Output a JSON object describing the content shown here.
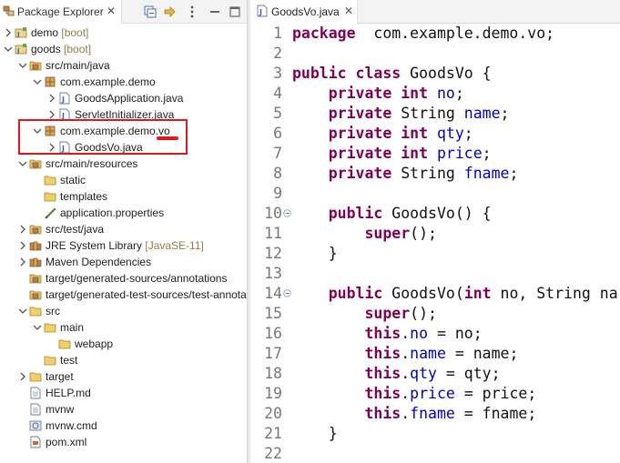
{
  "explorer": {
    "tab_title": "Package Explorer",
    "tab_close": "✕",
    "toolbar_icons": [
      "collapse-all-icon",
      "link-with-editor-icon",
      "focus-icon",
      "view-menu-icon"
    ]
  },
  "tree": [
    {
      "label": "demo",
      "decor": " [boot]",
      "icon": "project-icon",
      "arrow": "collapsed"
    },
    {
      "label": "goods",
      "decor": " [boot]",
      "icon": "project-icon",
      "arrow": "expanded"
    },
    {
      "label": "src/main/java",
      "decor": "",
      "icon": "source-folder-icon",
      "arrow": "expanded"
    },
    {
      "label": "com.example.demo",
      "decor": "",
      "icon": "package-icon",
      "arrow": "expanded"
    },
    {
      "label": "GoodsApplication.java",
      "decor": "",
      "icon": "java-file-icon",
      "arrow": "collapsed"
    },
    {
      "label": "ServletInitializer.java",
      "decor": "",
      "icon": "java-file-icon",
      "arrow": "collapsed"
    },
    {
      "label": "com.example.demo.vo",
      "decor": "",
      "icon": "package-icon",
      "arrow": "expanded"
    },
    {
      "label": "GoodsVo.java",
      "decor": "",
      "icon": "java-file-icon",
      "arrow": "collapsed"
    },
    {
      "label": "src/main/resources",
      "decor": "",
      "icon": "source-folder-icon",
      "arrow": "expanded"
    },
    {
      "label": "static",
      "decor": "",
      "icon": "folder-icon",
      "arrow": "none"
    },
    {
      "label": "templates",
      "decor": "",
      "icon": "folder-icon",
      "arrow": "none"
    },
    {
      "label": "application.properties",
      "decor": "",
      "icon": "properties-file-icon",
      "arrow": "none"
    },
    {
      "label": "src/test/java",
      "decor": "",
      "icon": "source-folder-icon",
      "arrow": "collapsed"
    },
    {
      "label": "JRE System Library",
      "decor": " [JavaSE-11]",
      "icon": "library-icon",
      "arrow": "collapsed"
    },
    {
      "label": "Maven Dependencies",
      "decor": "",
      "icon": "library-icon",
      "arrow": "collapsed"
    },
    {
      "label": "target/generated-sources/annotations",
      "decor": "",
      "icon": "source-folder-icon",
      "arrow": "none"
    },
    {
      "label": "target/generated-test-sources/test-annotations",
      "decor": "",
      "icon": "source-folder-icon",
      "arrow": "none"
    },
    {
      "label": "src",
      "decor": "",
      "icon": "folder-icon",
      "arrow": "expanded"
    },
    {
      "label": "main",
      "decor": "",
      "icon": "folder-icon",
      "arrow": "expanded"
    },
    {
      "label": "webapp",
      "decor": "",
      "icon": "folder-icon",
      "arrow": "none"
    },
    {
      "label": "test",
      "decor": "",
      "icon": "folder-icon",
      "arrow": "none"
    },
    {
      "label": "target",
      "decor": "",
      "icon": "folder-icon",
      "arrow": "collapsed"
    },
    {
      "label": "HELP.md",
      "decor": "",
      "icon": "text-file-icon",
      "arrow": "none"
    },
    {
      "label": "mvnw",
      "decor": "",
      "icon": "text-file-icon",
      "arrow": "none"
    },
    {
      "label": "mvnw.cmd",
      "decor": "",
      "icon": "cmd-file-icon",
      "arrow": "none"
    },
    {
      "label": "pom.xml",
      "decor": "",
      "icon": "xml-file-icon",
      "arrow": "none"
    }
  ],
  "editor": {
    "tab_title": "GoodsVo.java",
    "tab_close": "✕",
    "lines": [
      {
        "n": "1",
        "fold": false,
        "tokens": [
          [
            "kw",
            "package"
          ],
          [
            "",
            "  com.example.demo.vo;"
          ]
        ]
      },
      {
        "n": "2",
        "fold": false,
        "tokens": []
      },
      {
        "n": "3",
        "fold": false,
        "tokens": [
          [
            "kw",
            "public"
          ],
          [
            "",
            " "
          ],
          [
            "kw",
            "class"
          ],
          [
            "",
            " GoodsVo {"
          ]
        ]
      },
      {
        "n": "4",
        "fold": false,
        "tokens": [
          [
            "",
            "    "
          ],
          [
            "kw",
            "private"
          ],
          [
            "",
            " "
          ],
          [
            "kw",
            "int"
          ],
          [
            "",
            " "
          ],
          [
            "fld",
            "no"
          ],
          [
            "",
            ";"
          ]
        ]
      },
      {
        "n": "5",
        "fold": false,
        "tokens": [
          [
            "",
            "    "
          ],
          [
            "kw",
            "private"
          ],
          [
            "",
            " String "
          ],
          [
            "fld",
            "name"
          ],
          [
            "",
            ";"
          ]
        ]
      },
      {
        "n": "6",
        "fold": false,
        "tokens": [
          [
            "",
            "    "
          ],
          [
            "kw",
            "private"
          ],
          [
            "",
            " "
          ],
          [
            "kw",
            "int"
          ],
          [
            "",
            " "
          ],
          [
            "fld",
            "qty"
          ],
          [
            "",
            ";"
          ]
        ]
      },
      {
        "n": "7",
        "fold": false,
        "tokens": [
          [
            "",
            "    "
          ],
          [
            "kw",
            "private"
          ],
          [
            "",
            " "
          ],
          [
            "kw",
            "int"
          ],
          [
            "",
            " "
          ],
          [
            "fld",
            "price"
          ],
          [
            "",
            ";"
          ]
        ]
      },
      {
        "n": "8",
        "fold": false,
        "tokens": [
          [
            "",
            "    "
          ],
          [
            "kw",
            "private"
          ],
          [
            "",
            " String "
          ],
          [
            "fld",
            "fname"
          ],
          [
            "",
            ";"
          ]
        ]
      },
      {
        "n": "9",
        "fold": false,
        "tokens": []
      },
      {
        "n": "10",
        "fold": true,
        "tokens": [
          [
            "",
            "    "
          ],
          [
            "kw",
            "public"
          ],
          [
            "",
            " GoodsVo() {"
          ]
        ]
      },
      {
        "n": "11",
        "fold": false,
        "tokens": [
          [
            "",
            "        "
          ],
          [
            "kw",
            "super"
          ],
          [
            "",
            "();"
          ]
        ]
      },
      {
        "n": "12",
        "fold": false,
        "tokens": [
          [
            "",
            "    }"
          ]
        ]
      },
      {
        "n": "13",
        "fold": false,
        "tokens": []
      },
      {
        "n": "14",
        "fold": true,
        "tokens": [
          [
            "",
            "    "
          ],
          [
            "kw",
            "public"
          ],
          [
            "",
            " GoodsVo("
          ],
          [
            "kw",
            "int"
          ],
          [
            "",
            " no, String na"
          ]
        ]
      },
      {
        "n": "15",
        "fold": false,
        "tokens": [
          [
            "",
            "        "
          ],
          [
            "kw",
            "super"
          ],
          [
            "",
            "();"
          ]
        ]
      },
      {
        "n": "16",
        "fold": false,
        "tokens": [
          [
            "",
            "        "
          ],
          [
            "kw",
            "this"
          ],
          [
            "",
            "."
          ],
          [
            "fld",
            "no"
          ],
          [
            "",
            " = no;"
          ]
        ]
      },
      {
        "n": "17",
        "fold": false,
        "tokens": [
          [
            "",
            "        "
          ],
          [
            "kw",
            "this"
          ],
          [
            "",
            "."
          ],
          [
            "fld",
            "name"
          ],
          [
            "",
            " = name;"
          ]
        ]
      },
      {
        "n": "18",
        "fold": false,
        "tokens": [
          [
            "",
            "        "
          ],
          [
            "kw",
            "this"
          ],
          [
            "",
            "."
          ],
          [
            "fld",
            "qty"
          ],
          [
            "",
            " = qty;"
          ]
        ]
      },
      {
        "n": "19",
        "fold": false,
        "tokens": [
          [
            "",
            "        "
          ],
          [
            "kw",
            "this"
          ],
          [
            "",
            "."
          ],
          [
            "fld",
            "price"
          ],
          [
            "",
            " = price;"
          ]
        ]
      },
      {
        "n": "20",
        "fold": false,
        "tokens": [
          [
            "",
            "        "
          ],
          [
            "kw",
            "this"
          ],
          [
            "",
            "."
          ],
          [
            "fld",
            "fname"
          ],
          [
            "",
            " = fname;"
          ]
        ]
      },
      {
        "n": "21",
        "fold": false,
        "tokens": [
          [
            "",
            "    }"
          ]
        ]
      },
      {
        "n": "22",
        "fold": false,
        "tokens": []
      }
    ]
  },
  "colors": {
    "keyword": "#7f0055",
    "field": "#0000c0",
    "highlight": "#e3171b",
    "decoration": "#957d47"
  }
}
